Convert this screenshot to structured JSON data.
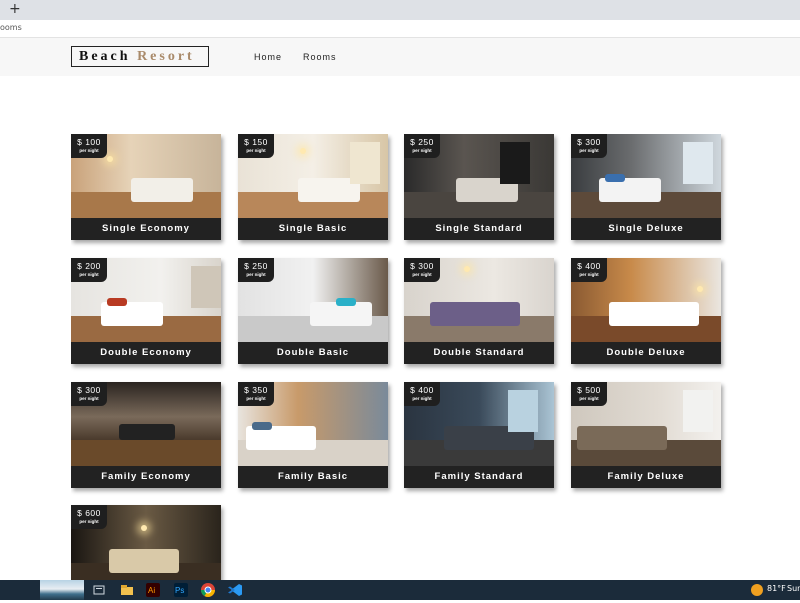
{
  "browser": {
    "new_tab_icon": "plus",
    "address_fragment": "ooms"
  },
  "nav": {
    "logo_word1": "Beach",
    "logo_word2": "Resort",
    "links": [
      "Home",
      "Rooms"
    ]
  },
  "colors": {
    "logo_accent": "#a98a6a",
    "card_label_bg": "#222222",
    "taskbar_bg": "#1b2b3a"
  },
  "per_night": "per night",
  "rooms": [
    {
      "price": "$ 100",
      "name": "Single Economy"
    },
    {
      "price": "$ 150",
      "name": "Single Basic"
    },
    {
      "price": "$ 250",
      "name": "Single Standard"
    },
    {
      "price": "$ 300",
      "name": "Single Deluxe"
    },
    {
      "price": "$ 200",
      "name": "Double Economy"
    },
    {
      "price": "$ 250",
      "name": "Double Basic"
    },
    {
      "price": "$ 300",
      "name": "Double Standard"
    },
    {
      "price": "$ 400",
      "name": "Double Deluxe"
    },
    {
      "price": "$ 300",
      "name": "Family Economy"
    },
    {
      "price": "$ 350",
      "name": "Family Basic"
    },
    {
      "price": "$ 400",
      "name": "Family Standard"
    },
    {
      "price": "$ 500",
      "name": "Family Deluxe"
    },
    {
      "price": "$ 600",
      "name": ""
    }
  ],
  "taskbar": {
    "icons": [
      "file-explorer-icon",
      "illustrator-icon",
      "photoshop-icon",
      "chrome-icon",
      "vscode-icon"
    ],
    "weather_temp": "81°F",
    "weather_text": "Sun"
  }
}
